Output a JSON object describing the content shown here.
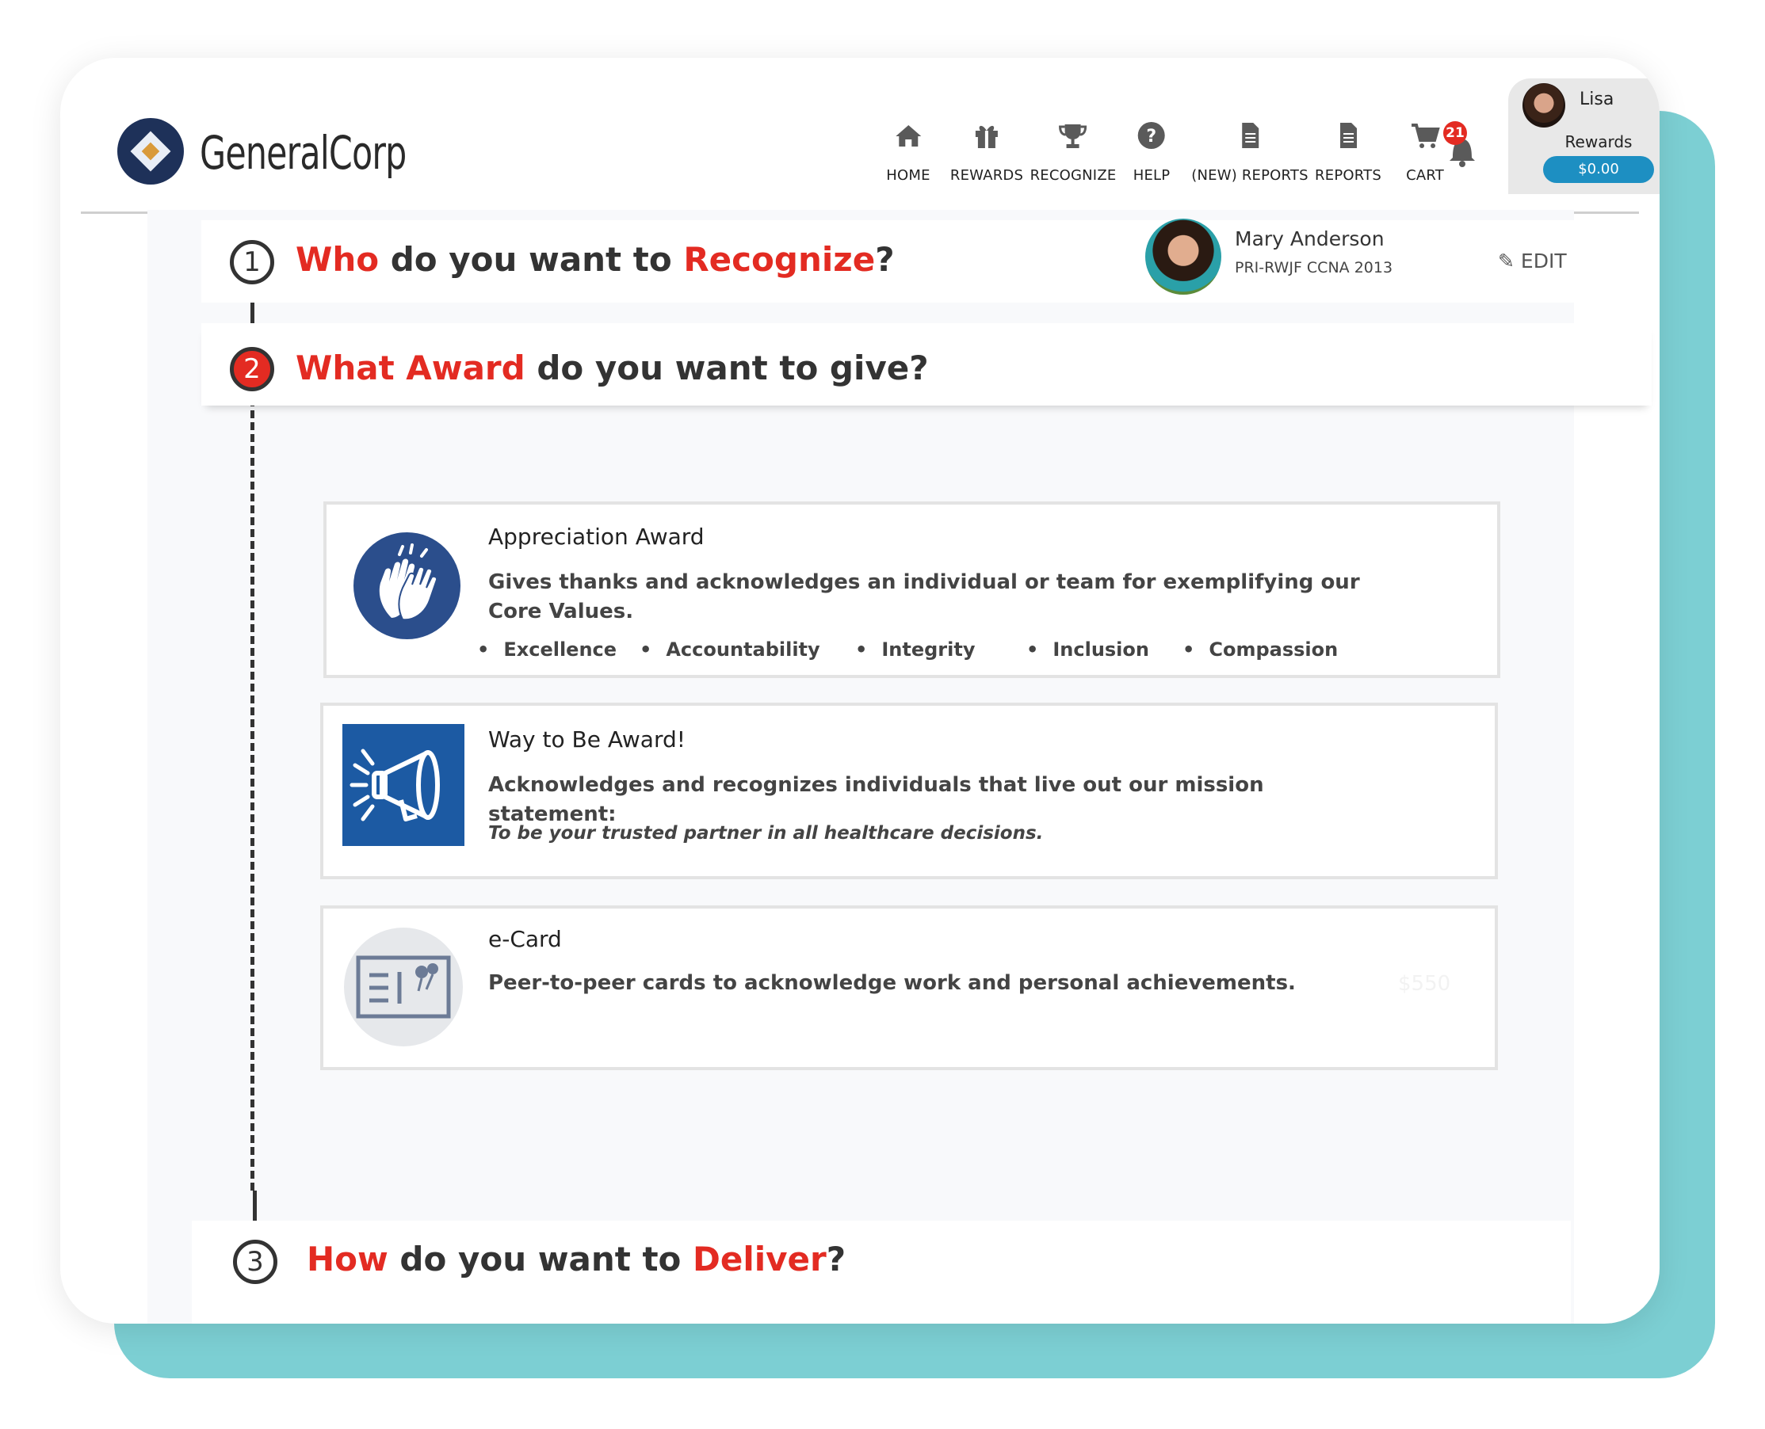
{
  "brand": {
    "name": "GeneralCorp"
  },
  "nav": [
    {
      "label": "HOME",
      "icon": "home-icon"
    },
    {
      "label": "REWARDS",
      "icon": "gift-icon"
    },
    {
      "label": "RECOGNIZE",
      "icon": "trophy-icon"
    },
    {
      "label": "HELP",
      "icon": "help-icon"
    },
    {
      "label": "(NEW) REPORTS",
      "icon": "document-icon"
    },
    {
      "label": "REPORTS",
      "icon": "document-icon"
    },
    {
      "label": "CART",
      "icon": "cart-icon"
    }
  ],
  "notifications": {
    "count": "21",
    "icon": "bell-icon"
  },
  "user": {
    "name": "Lisa",
    "rewards_label": "Rewards",
    "balance": "$0.00"
  },
  "steps": [
    {
      "number": "1",
      "parts": [
        "Who",
        " do you want to ",
        "Recognize",
        "?"
      ]
    },
    {
      "number": "2",
      "parts": [
        "What Award",
        " do you want to give?"
      ]
    },
    {
      "number": "3",
      "parts": [
        "How",
        " do you want to ",
        "Deliver",
        "?"
      ]
    }
  ],
  "recipient": {
    "name": "Mary Anderson",
    "subtitle": "PRI-RWJF CCNA 2013",
    "edit_label": "EDIT"
  },
  "awards": [
    {
      "title": "Appreciation Award",
      "description": "Gives thanks and acknowledges an individual or team for exemplifying our Core Values.",
      "values": [
        "Excellence",
        "Accountability",
        "Integrity",
        "Inclusion",
        "Compassion"
      ],
      "icon": "high-five-icon"
    },
    {
      "title": "Way to Be Award!",
      "description": "Acknowledges and recognizes individuals that live out our mission statement:",
      "note": "To be your trusted partner in all healthcare decisions.",
      "icon": "megaphone-icon"
    },
    {
      "title": "e-Card",
      "description": "Peer-to-peer cards to acknowledge work and personal achievements.",
      "amount": "$550",
      "icon": "ecard-icon"
    }
  ],
  "colors": {
    "accent": "#e32b22",
    "teal": "#7ccfd3",
    "brand_navy": "#1e3159",
    "award_blue": "#1c5aa3"
  }
}
